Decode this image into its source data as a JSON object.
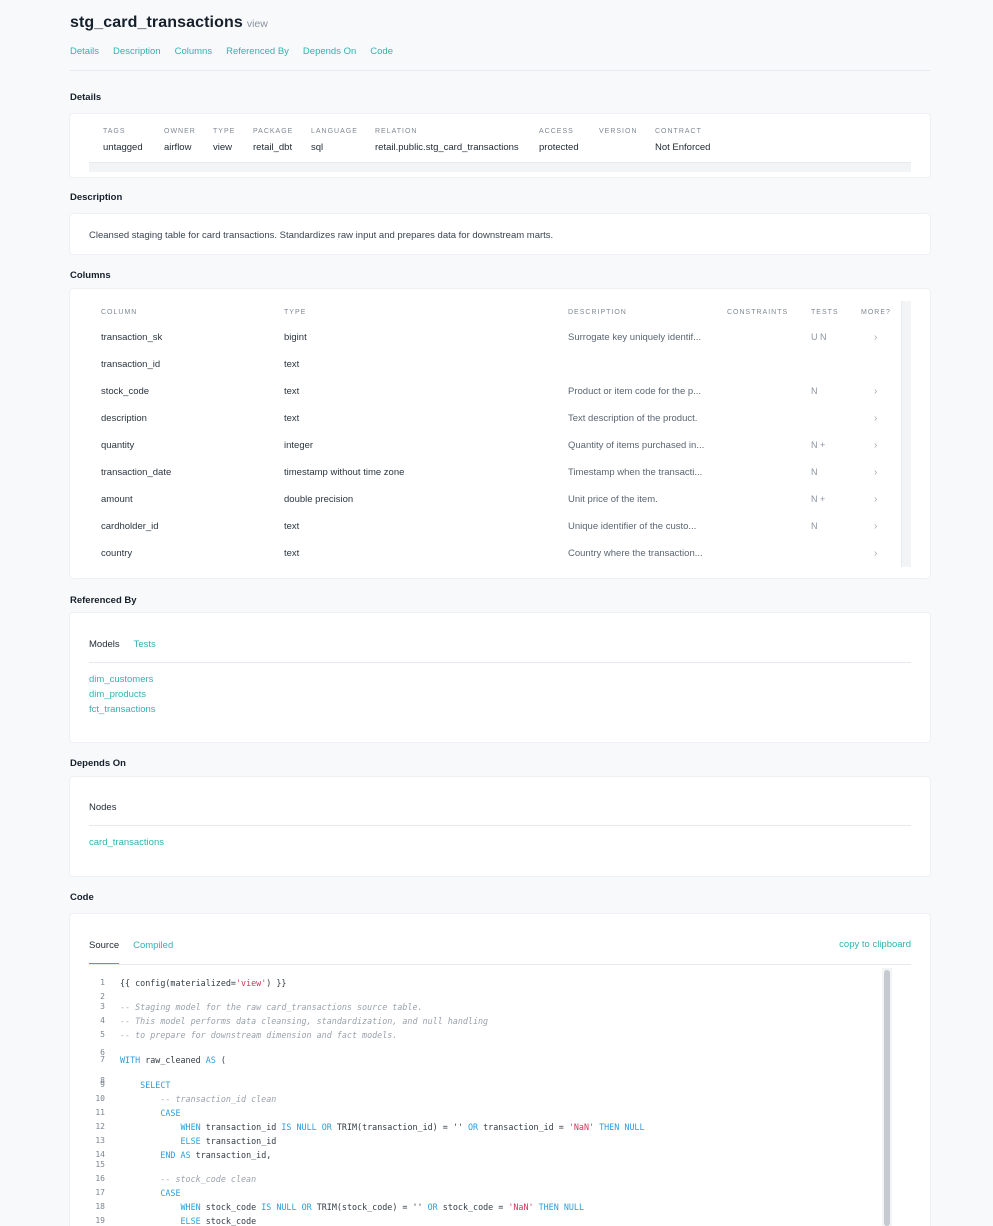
{
  "header": {
    "title": "stg_card_transactions",
    "type": "view"
  },
  "nav": [
    "Details",
    "Description",
    "Columns",
    "Referenced By",
    "Depends On",
    "Code"
  ],
  "sections": {
    "details": "Details",
    "description": "Description",
    "columns": "Columns",
    "referenced_by": "Referenced By",
    "depends_on": "Depends On",
    "code": "Code"
  },
  "details": [
    {
      "label": "TAGS",
      "value": "untagged"
    },
    {
      "label": "OWNER",
      "value": "airflow"
    },
    {
      "label": "TYPE",
      "value": "view"
    },
    {
      "label": "PACKAGE",
      "value": "retail_dbt"
    },
    {
      "label": "LANGUAGE",
      "value": "sql"
    },
    {
      "label": "RELATION",
      "value": "retail.public.stg_card_transactions"
    },
    {
      "label": "ACCESS",
      "value": "protected"
    },
    {
      "label": "VERSION",
      "value": ""
    },
    {
      "label": "CONTRACT",
      "value": "Not Enforced"
    }
  ],
  "description": "Cleansed staging table for card transactions. Standardizes raw input and prepares data for downstream marts.",
  "columns": {
    "headers": [
      "COLUMN",
      "TYPE",
      "DESCRIPTION",
      "CONSTRAINTS",
      "TESTS",
      "MORE?"
    ],
    "rows": [
      {
        "column": "transaction_sk",
        "type": "bigint",
        "description": "Surrogate key uniquely identif...",
        "constraints": "",
        "tests": "U N",
        "more": "›"
      },
      {
        "column": "transaction_id",
        "type": "text",
        "description": "",
        "constraints": "",
        "tests": "",
        "more": ""
      },
      {
        "column": "stock_code",
        "type": "text",
        "description": "Product or item code for the p...",
        "constraints": "",
        "tests": "N",
        "more": "›"
      },
      {
        "column": "description",
        "type": "text",
        "description": "Text description of the product.",
        "constraints": "",
        "tests": "",
        "more": "›"
      },
      {
        "column": "quantity",
        "type": "integer",
        "description": "Quantity of items purchased in...",
        "constraints": "",
        "tests": "N +",
        "more": "›"
      },
      {
        "column": "transaction_date",
        "type": "timestamp without time zone",
        "description": "Timestamp when the transacti...",
        "constraints": "",
        "tests": "N",
        "more": "›"
      },
      {
        "column": "amount",
        "type": "double precision",
        "description": "Unit price of the item.",
        "constraints": "",
        "tests": "N +",
        "more": "›"
      },
      {
        "column": "cardholder_id",
        "type": "text",
        "description": "Unique identifier of the custo...",
        "constraints": "",
        "tests": "N",
        "more": "›"
      },
      {
        "column": "country",
        "type": "text",
        "description": "Country where the transaction...",
        "constraints": "",
        "tests": "",
        "more": "›"
      }
    ]
  },
  "referenced_by": {
    "tabs": [
      "Models",
      "Tests"
    ],
    "items": [
      "dim_customers",
      "dim_products",
      "fct_transactions"
    ]
  },
  "depends_on": {
    "tabs": [
      "Nodes"
    ],
    "items": [
      "card_transactions"
    ]
  },
  "code": {
    "tabs": [
      "Source",
      "Compiled"
    ],
    "copy_label": "copy to clipboard",
    "lines": [
      "{{ config(materialized='view') }}",
      "",
      "-- Staging model for the raw card_transactions source table.",
      "-- This model performs data cleansing, standardization, and null handling",
      "-- to prepare for downstream dimension and fact models.",
      "",
      "WITH raw_cleaned AS (",
      "",
      "    SELECT",
      "        -- transaction_id clean",
      "        CASE",
      "            WHEN transaction_id IS NULL OR TRIM(transaction_id) = '' OR transaction_id = 'NaN' THEN NULL",
      "            ELSE transaction_id",
      "        END AS transaction_id,",
      "",
      "        -- stock_code clean",
      "        CASE",
      "            WHEN stock_code IS NULL OR TRIM(stock_code) = '' OR stock_code = 'NaN' THEN NULL",
      "            ELSE stock_code"
    ]
  }
}
